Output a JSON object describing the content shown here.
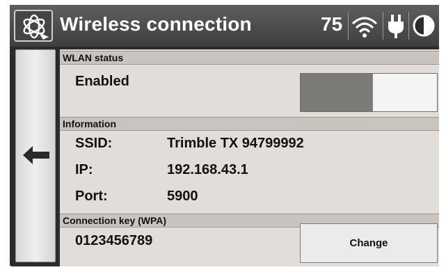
{
  "header": {
    "title": "Wireless connection",
    "battery_level": "75",
    "icons": [
      "trimble-logo-icon",
      "wifi-icon",
      "power-plug-icon",
      "contrast-icon"
    ]
  },
  "nav": {
    "back_icon": "arrow-left-icon"
  },
  "wlan": {
    "section_label": "WLAN status",
    "status": "Enabled",
    "toggle_on": true
  },
  "information": {
    "section_label": "Information",
    "ssid_label": "SSID:",
    "ssid_value": "Trimble TX 94799992",
    "ip_label": "IP:",
    "ip_value": "192.168.43.1",
    "port_label": "Port:",
    "port_value": "5900"
  },
  "connection_key": {
    "section_label": "Connection key (WPA)",
    "value": "0123456789",
    "change_label": "Change"
  },
  "colors": {
    "header_bg": "#4a4a4a",
    "content_bg": "#e1ded9",
    "section_bg": "#c9c5be",
    "toggle_track": "#7d7b77"
  }
}
